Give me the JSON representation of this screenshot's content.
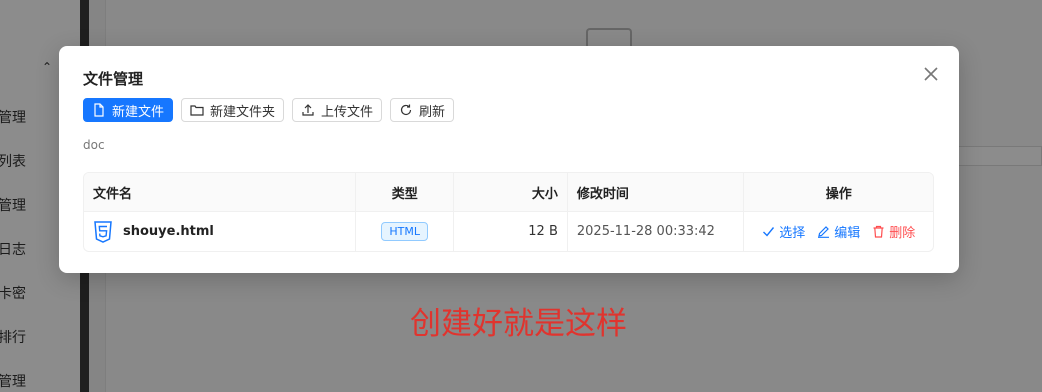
{
  "background": {
    "nav_items": [
      "管理",
      "列表",
      "管理",
      "日志",
      "卡密",
      "排行",
      "管理"
    ]
  },
  "modal": {
    "title": "文件管理",
    "toolbar": {
      "new_file": "新建文件",
      "new_folder": "新建文件夹",
      "upload": "上传文件",
      "refresh": "刷新"
    },
    "path": "doc",
    "table": {
      "headers": {
        "name": "文件名",
        "type": "类型",
        "size": "大小",
        "modified": "修改时间",
        "actions": "操作"
      },
      "rows": [
        {
          "name": "shouye.html",
          "type": "HTML",
          "size": "12 B",
          "modified": "2025-11-28 00:33:42",
          "actions": {
            "select": "选择",
            "edit": "编辑",
            "delete": "删除"
          }
        }
      ]
    }
  },
  "caption": "创建好就是这样",
  "colors": {
    "primary": "#1677ff",
    "danger": "#ff4d4f",
    "caption": "#e0342e"
  }
}
